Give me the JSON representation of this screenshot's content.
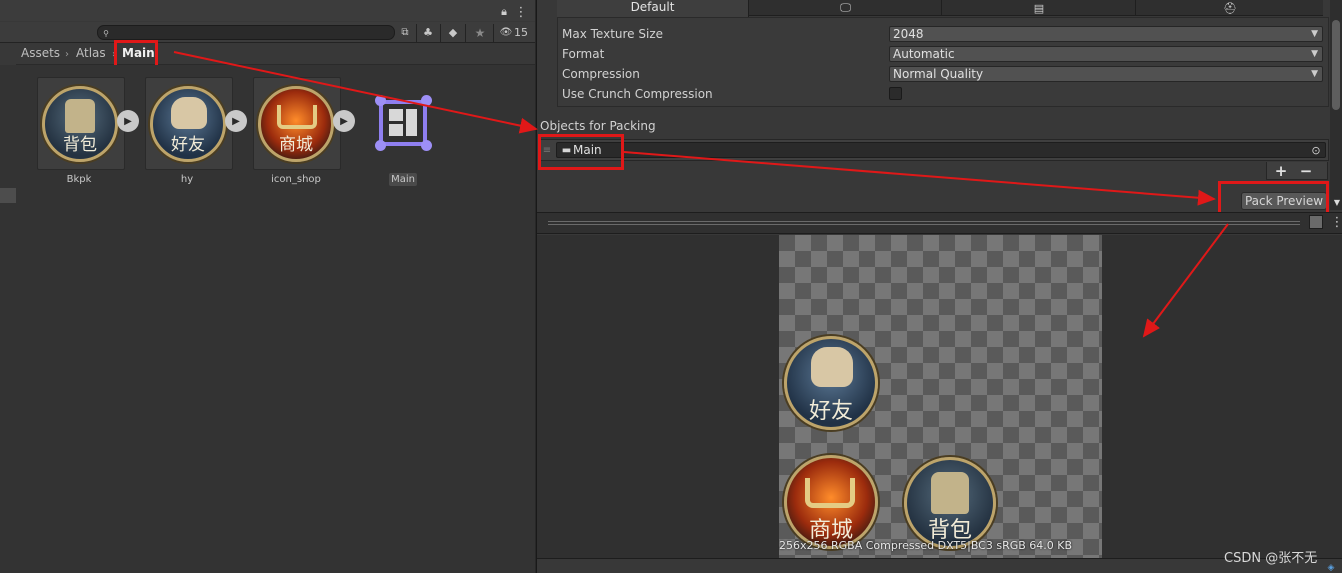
{
  "project": {
    "search_placeholder": "",
    "hidden_count": "15",
    "breadcrumb": [
      "Assets",
      "Atlas",
      "Main"
    ],
    "assets": [
      {
        "label": "Bkpk",
        "glyph": "背包",
        "icon": "backpack-icon"
      },
      {
        "label": "hy",
        "glyph": "好友",
        "icon": "friends-icon"
      },
      {
        "label": "icon_shop",
        "glyph": "商城",
        "icon": "shop-icon"
      },
      {
        "label": "Main",
        "icon": "sprite-atlas-icon"
      }
    ]
  },
  "inspector": {
    "tabs": [
      "Default",
      "standalone-monitor-icon",
      "server-icon",
      "android-icon"
    ],
    "settings": [
      {
        "label": "Max Texture Size",
        "value": "2048"
      },
      {
        "label": "Format",
        "value": "Automatic"
      },
      {
        "label": "Compression",
        "value": "Normal Quality"
      },
      {
        "label": "Use Crunch Compression",
        "value": ""
      }
    ],
    "objects_header": "Objects for Packing",
    "packing_item": "Main",
    "add_label": "+",
    "remove_label": "−",
    "pack_preview_label": "Pack Preview"
  },
  "preview": {
    "glyphs": [
      "好友",
      "商城",
      "背包"
    ],
    "info": "256x256 RGBA Compressed DXT5|BC3 sRGB  64.0 KB"
  },
  "watermark": "CSDN @张不无",
  "colors": {
    "highlight": "#e01818",
    "atlas_icon": "#8f7ff0",
    "medal_rim": "#bda46a"
  }
}
